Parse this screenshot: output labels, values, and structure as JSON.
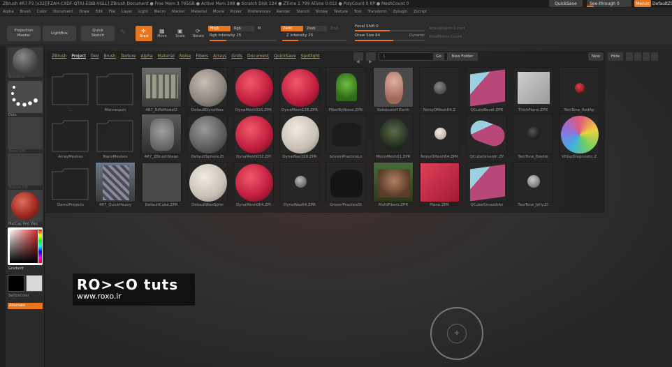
{
  "titlebar": {
    "text": "ZBrush 4R7 P3 [x32][FZAH-CXDF-QTIU-EDBI-VGLL]   ZBrush Document     ● Free Mem 3.795GB ● Active Mem 398 ● Scratch Disk 124 ● ZTime 1.799 ATime 0.012 ● PolyCount 0 KP ● MeshCount 0",
    "quicksave": "QuickSave",
    "seethrough": "See-through  0",
    "menus": "Menus",
    "default_script": "DefaultZScript"
  },
  "menubar": {
    "items": [
      "Alpha",
      "Brush",
      "Color",
      "Document",
      "Draw",
      "Edit",
      "File",
      "Layer",
      "Light",
      "Macro",
      "Marker",
      "Material",
      "Movie",
      "Picker",
      "Preferences",
      "Render",
      "Stencil",
      "Stroke",
      "Texture",
      "Tool",
      "Transform",
      "Zplugin",
      "Zscript"
    ]
  },
  "toolbar": {
    "projection_master": [
      "Projection",
      "Master"
    ],
    "lightbox": "LightBox",
    "quick_sketch": [
      "Quick",
      "Sketch"
    ],
    "modes": {
      "draw": "Draw",
      "move": "Move",
      "scale": "Scale",
      "rotate": "Rotate"
    },
    "mrgb": "Mrgb",
    "rgb": "Rgb",
    "m": "M",
    "zadd": "Zadd",
    "zsub": "Zsub",
    "zcut": "Zcut",
    "rgb_intensity": "Rgb Intensity 25",
    "z_intensity": "Z Intensity 25",
    "focal_shift": "Focal Shift 0",
    "draw_size": "Draw Size 64",
    "dynamic": "Dynamic",
    "active_points": "ActivePoints Count",
    "total_points": "TotalPoints Count",
    "rgb_intensity_fill": 0.25,
    "z_intensity_fill": 0.25,
    "focal_fill": 0.5,
    "drawsize_fill": 0.55
  },
  "leftpanel": {
    "material_label": "Standard",
    "dots_label": "Dots",
    "alpha_label": "Alpha Off",
    "texture_label": "Texture Off",
    "matcap_label": "MatCap Red Wax",
    "gradient_label": "Gradient",
    "switchcolor_label": "SwitchColor",
    "alternate_label": "Alternate"
  },
  "lightbox": {
    "tabs": [
      "ZBrush",
      "Project",
      "Tool",
      "Brush",
      "Texture",
      "Alpha",
      "Material",
      "Noise",
      "Fibers",
      "Arrays",
      "Grids",
      "Document",
      "QuickSave",
      "Spotlight"
    ],
    "active_tab": "Project",
    "path": ".\\",
    "go": "Go",
    "new_folder": "New Folder",
    "new": "New",
    "hide": "Hide",
    "rows": [
      [
        "..",
        "Mannequin",
        "4R7_RifleModel2",
        "DefaultDynaWax",
        "DynaMesh016.ZPR",
        "DynaMesh128.ZPR",
        "FiberByNoise.ZPR",
        "Kotobukoff Earth",
        "NoisyDMesh64.Z",
        "QCubeBevel.ZPR",
        "ThickPlane.ZPR",
        "TwoTone_RedAp"
      ],
      [
        "ArrayMeshes",
        "NanoMeshes",
        "4R7_ZBrushStean",
        "DefaultSphere.ZI",
        "DynaMesh032.ZPI",
        "DynaWax128.ZPR",
        "GroomPracticeLo",
        "MicroMesh01.ZPR",
        "NoisyDMesh64.ZPR",
        "QCubeSmooth.ZP",
        "TwoTone_Beetle",
        "VDispDiagnostic.Z"
      ],
      [
        "DemoProjects",
        "4R7_QuickHeavy",
        "DefaultCube.ZPR",
        "DefaultWaxSphe",
        "DynaMesh064.ZPI",
        "DynaWax64.ZPR",
        "GroomPractice5t",
        "MultiFibers.ZPR",
        "Plane.ZPR",
        "QCubeSmoothAn",
        "TwoTone_Jelly.ZI",
        ""
      ]
    ]
  },
  "watermark": {
    "logo": "RO><O tuts",
    "url": "www.roxo.ir"
  },
  "colors": {
    "accent": "#e8761f",
    "tab_link": "#c4a060"
  }
}
